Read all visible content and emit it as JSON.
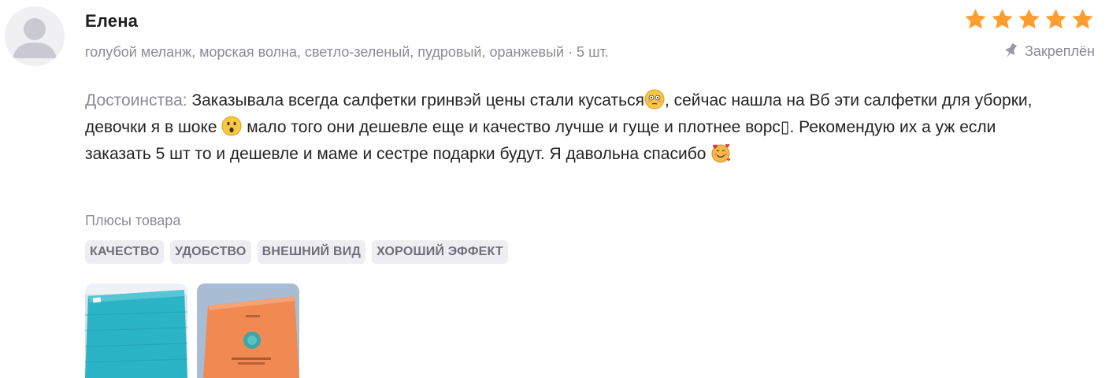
{
  "review": {
    "author": "Елена",
    "variant": "голубой меланж, морская волна, светло-зеленый, пудровый, оранжевый · 5 шт.",
    "rating": 5,
    "rating_max": 5,
    "pinned_label": "Закреплён",
    "advantages_label": "Достоинства:",
    "text_1": "Заказывала всегда салфетки гринвэй цены стали кусаться",
    "text_2": ", сейчас нашла на Вб эти салфетки для уборки, девочки я в шоке ",
    "text_3": " мало того они дешевле еще и качество лучше и гуще и плотнее ворс▯. Рекомендую их а уж если заказать 5 шт то и дешевле и маме и сестре подарки будут. Я давольна спасибо ",
    "pluses_title": "Плюсы товара",
    "tags": [
      "КАЧЕСТВО",
      "УДОБСТВО",
      "ВНЕШНИЙ ВИД",
      "ХОРОШИЙ ЭФФЕКТ"
    ],
    "photos": [
      {
        "icon": "teal-cloth-photo"
      },
      {
        "icon": "orange-package-photo"
      }
    ]
  },
  "colors": {
    "star": "#ff9d2e",
    "muted_text": "#8b8b96",
    "tag_bg": "#eeeef2",
    "main_text": "#242424"
  }
}
